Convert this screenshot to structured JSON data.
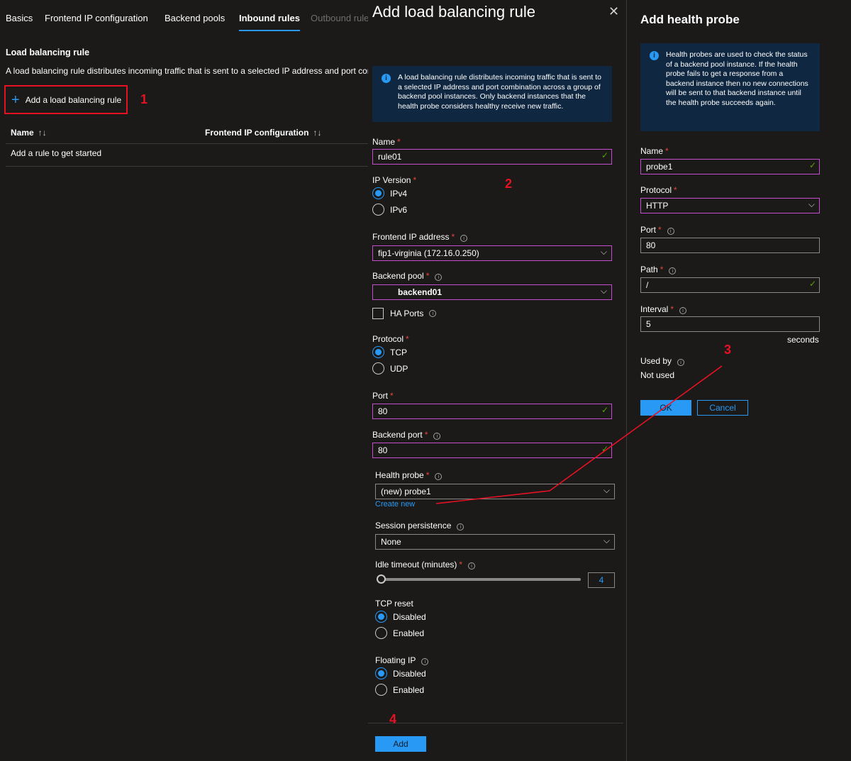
{
  "tabs": [
    {
      "label": "Basics"
    },
    {
      "label": "Frontend IP configuration"
    },
    {
      "label": "Backend pools"
    },
    {
      "label": "Inbound rules"
    },
    {
      "label": "Outbound rules"
    }
  ],
  "page": {
    "section_title": "Load balancing rule",
    "section_description": "A load balancing rule distributes incoming traffic that is sent to a selected IP address and port combination across a group of backend pool instances.",
    "add_rule_label": "Add a load balancing rule",
    "table": {
      "columns": [
        "Name",
        "Frontend IP configuration"
      ],
      "sort_glyph": "↑↓",
      "empty_text": "Add a rule to get started"
    }
  },
  "rule_blade": {
    "title": "Add load balancing rule",
    "info_text": "A load balancing rule distributes incoming traffic that is sent to a selected IP address and port combination across a group of backend pool instances. Only backend instances that the health probe considers healthy receive new traffic.",
    "name": {
      "label": "Name",
      "value": "rule01"
    },
    "ip_version": {
      "label": "IP Version",
      "options": [
        "IPv4",
        "IPv6"
      ],
      "selected": "IPv4"
    },
    "frontend_ip": {
      "label": "Frontend IP address",
      "value": "fip1-virginia (172.16.0.250)"
    },
    "backend_pool": {
      "label": "Backend pool",
      "value": "backend01"
    },
    "ha_ports": {
      "label": "HA Ports",
      "checked": false
    },
    "protocol": {
      "label": "Protocol",
      "options": [
        "TCP",
        "UDP"
      ],
      "selected": "TCP"
    },
    "port": {
      "label": "Port",
      "value": "80"
    },
    "backend_port": {
      "label": "Backend port",
      "value": "80"
    },
    "health_probe": {
      "label": "Health probe",
      "value": "(new) probe1",
      "create_new": "Create new"
    },
    "session_persistence": {
      "label": "Session persistence",
      "value": "None"
    },
    "idle_timeout": {
      "label": "Idle timeout (minutes)",
      "value": "4"
    },
    "tcp_reset": {
      "label": "TCP reset",
      "options": [
        "Disabled",
        "Enabled"
      ],
      "selected": "Disabled"
    },
    "floating_ip": {
      "label": "Floating IP",
      "options": [
        "Disabled",
        "Enabled"
      ],
      "selected": "Disabled"
    },
    "add_label": "Add"
  },
  "probe_blade": {
    "title": "Add health probe",
    "info_text": "Health probes are used to check the status of a backend pool instance. If the health probe fails to get a response from a backend instance then no new connections will be sent to that backend instance until the health probe succeeds again.",
    "name": {
      "label": "Name",
      "value": "probe1"
    },
    "protocol": {
      "label": "Protocol",
      "value": "HTTP"
    },
    "port": {
      "label": "Port",
      "value": "80"
    },
    "path": {
      "label": "Path",
      "value": "/"
    },
    "interval": {
      "label": "Interval",
      "value": "5",
      "unit": "seconds"
    },
    "used_by": {
      "label": "Used by",
      "value": "Not used"
    },
    "ok_label": "OK",
    "cancel_label": "Cancel"
  },
  "annotations": [
    "1",
    "2",
    "3",
    "4"
  ],
  "glyphs": {
    "required": "*",
    "info": "i",
    "check": "✓",
    "chevron": "⌵",
    "close": "✕",
    "plus": "+"
  },
  "colors": {
    "accent": "#2899f5",
    "annotation": "#e81123",
    "valid": "#57a300",
    "focus_border": "#c74dd0",
    "info_bg": "#0f2740"
  }
}
